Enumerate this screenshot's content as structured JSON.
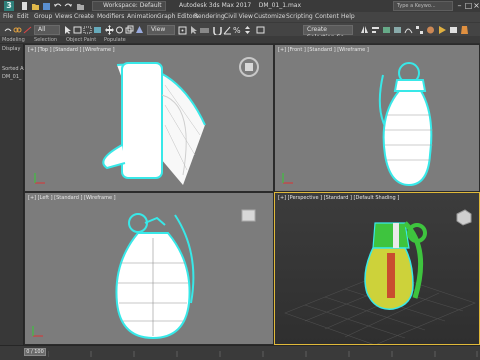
{
  "titlebar": {
    "workspace_label": "Workspace: Default",
    "app_title": "Autodesk 3ds Max 2017",
    "file_name": "DM_01_1.max",
    "search_placeholder": "Type a Keywo..."
  },
  "menu": [
    "File",
    "Edit",
    "Group",
    "Views",
    "Create",
    "Modifiers",
    "Animation",
    "Graph Editors",
    "Rendering",
    "Civil View",
    "Customize",
    "Scripting",
    "Content",
    "Help"
  ],
  "toolbar": {
    "filter_value": "All",
    "view_value": "View",
    "selection_set_value": "Create Selection Se"
  },
  "ribbon": [
    "Modeling",
    "Selection",
    "Object Paint",
    "Populate"
  ],
  "left_panel": {
    "mode_label": "Display",
    "section_label": "Sorted Ascen",
    "object_label": "DM_01_"
  },
  "viewports": {
    "top": "[+] [Top ] [Standard ] [Wireframe ]",
    "front": "[+] [Front ] [Standard ] [Wireframe ]",
    "left": "[+] [Left ] [Standard ] [Wireframe ]",
    "perspective": "[+] [Perspective ] [Standard ] [Default Shading ]"
  },
  "timeline": {
    "frame_range": "0 / 100"
  },
  "colors": {
    "ortho_bg": "#7c7c7c",
    "active_border": "#e0b93a",
    "selection_cyan": "#38e8e8",
    "grenade_green": "#3ec43e",
    "grenade_yellow": "#cdd23a"
  }
}
